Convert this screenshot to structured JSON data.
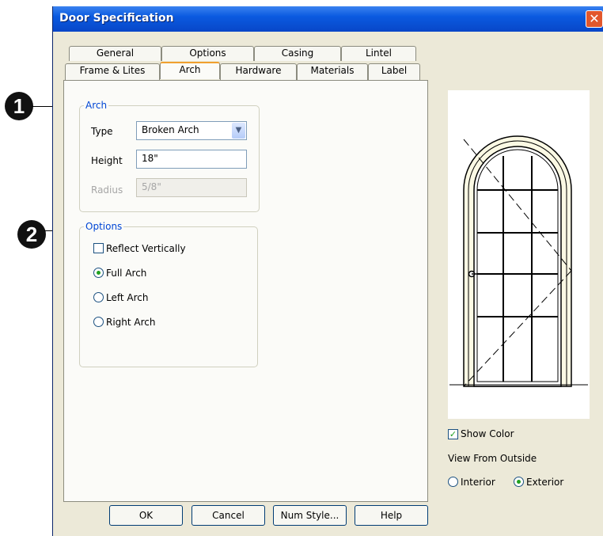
{
  "window": {
    "title": "Door Specification",
    "close_glyph": "✕"
  },
  "callouts": [
    "1",
    "2"
  ],
  "tabs_row1": [
    "General",
    "Options",
    "Casing",
    "Lintel"
  ],
  "tabs_row2": [
    "Frame & Lites",
    "Arch",
    "Hardware",
    "Materials",
    "Label"
  ],
  "active_tab": "Arch",
  "arch_group": {
    "legend": "Arch",
    "type_label": "Type",
    "type_value": "Broken Arch",
    "height_label": "Height",
    "height_value": "18\"",
    "radius_label": "Radius",
    "radius_value": "5/8\""
  },
  "options_group": {
    "legend": "Options",
    "reflect_label": "Reflect Vertically",
    "reflect_checked": false,
    "radios": [
      {
        "label": "Full Arch",
        "selected": true
      },
      {
        "label": "Left Arch",
        "selected": false
      },
      {
        "label": "Right Arch",
        "selected": false
      }
    ]
  },
  "preview": {
    "show_color_label": "Show Color",
    "show_color_checked": true,
    "view_from_label": "View From Outside",
    "interior_label": "Interior",
    "exterior_label": "Exterior",
    "selected_view": "Exterior"
  },
  "buttons": {
    "ok": "OK",
    "cancel": "Cancel",
    "num_style": "Num Style...",
    "help": "Help"
  }
}
